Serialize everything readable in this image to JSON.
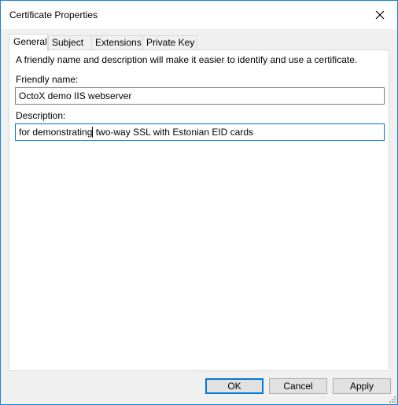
{
  "window": {
    "title": "Certificate Properties"
  },
  "tabs": [
    {
      "label": "General",
      "active": true
    },
    {
      "label": "Subject",
      "active": false
    },
    {
      "label": "Extensions",
      "active": false
    },
    {
      "label": "Private Key",
      "active": false
    }
  ],
  "general": {
    "intro": "A friendly name and description will make it easier to identify and use a certificate.",
    "friendly_name_label": "Friendly name:",
    "friendly_name_value": "OctoX demo IIS webserver",
    "description_label": "Description:",
    "description_value_before_caret": "for demonstrating",
    "description_value_after_caret": " two-way SSL with Estonian EID cards"
  },
  "buttons": {
    "ok": "OK",
    "cancel": "Cancel",
    "apply": "Apply"
  },
  "icons": {
    "close": "close-icon",
    "resize": "resize-grip-icon"
  },
  "colors": {
    "accent": "#0078d7",
    "window_border": "#1883d7"
  }
}
